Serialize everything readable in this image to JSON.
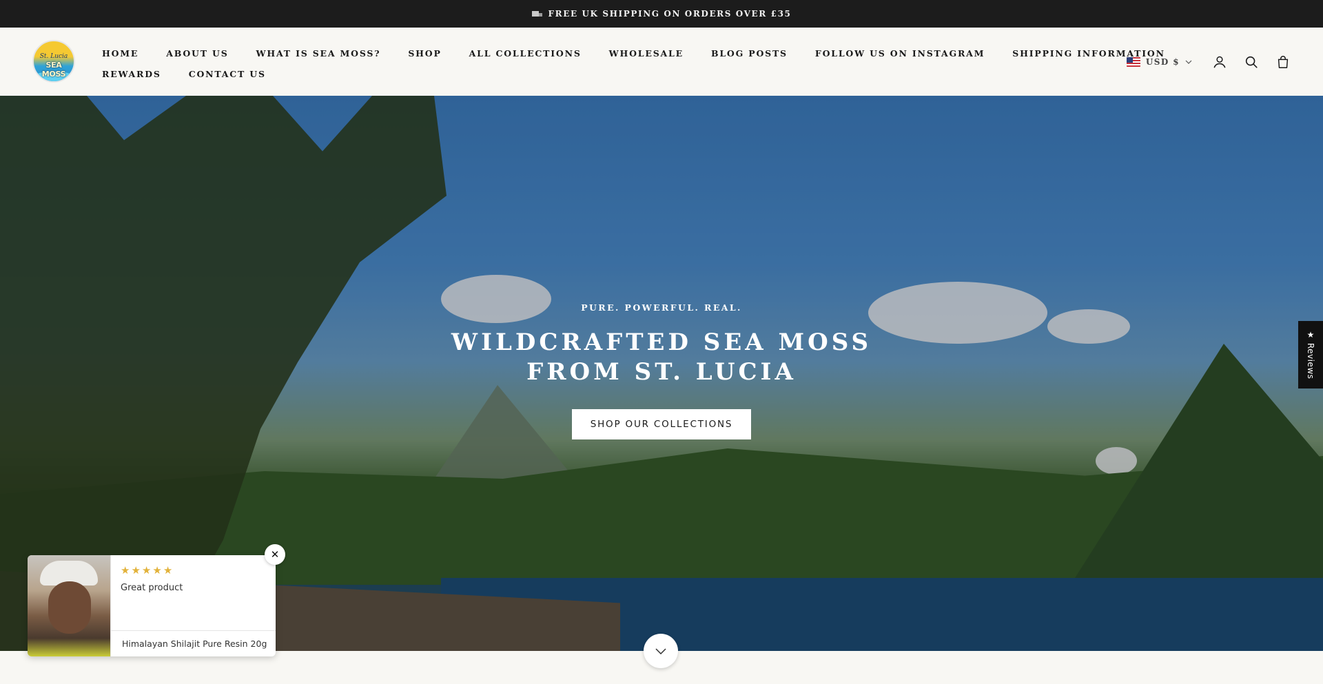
{
  "announcement": {
    "icon": "truck-icon",
    "text": "FREE UK SHIPPING ON ORDERS OVER £35"
  },
  "logo": {
    "line1": "St. Lucia",
    "line2": "SEA MOSS"
  },
  "nav": {
    "row1": [
      "HOME",
      "ABOUT US",
      "WHAT IS SEA MOSS?",
      "SHOP",
      "ALL COLLECTIONS",
      "WHOLESALE",
      "BLOG POSTS",
      "FOLLOW US ON INSTAGRAM",
      "SHIPPING INFORMATION"
    ],
    "row2": [
      "REWARDS",
      "CONTACT US"
    ]
  },
  "header_right": {
    "currency": "USD $",
    "icons": [
      "account-icon",
      "search-icon",
      "cart-icon"
    ]
  },
  "hero": {
    "eyebrow": "PURE. POWERFUL. REAL.",
    "title": "WILDCRAFTED SEA MOSS FROM ST. LUCIA",
    "cta": "SHOP OUR COLLECTIONS"
  },
  "reviews_tab": {
    "label": "★ Reviews"
  },
  "review_popup": {
    "rating": 5,
    "text": "Great product",
    "product": "Himalayan Shilajit Pure Resin 20g",
    "close": "✕"
  },
  "colors": {
    "announcement_bg": "#1c1c1c",
    "header_bg": "#f8f7f3",
    "star": "#e2b23a",
    "reviews_tab_bg": "#111111"
  }
}
